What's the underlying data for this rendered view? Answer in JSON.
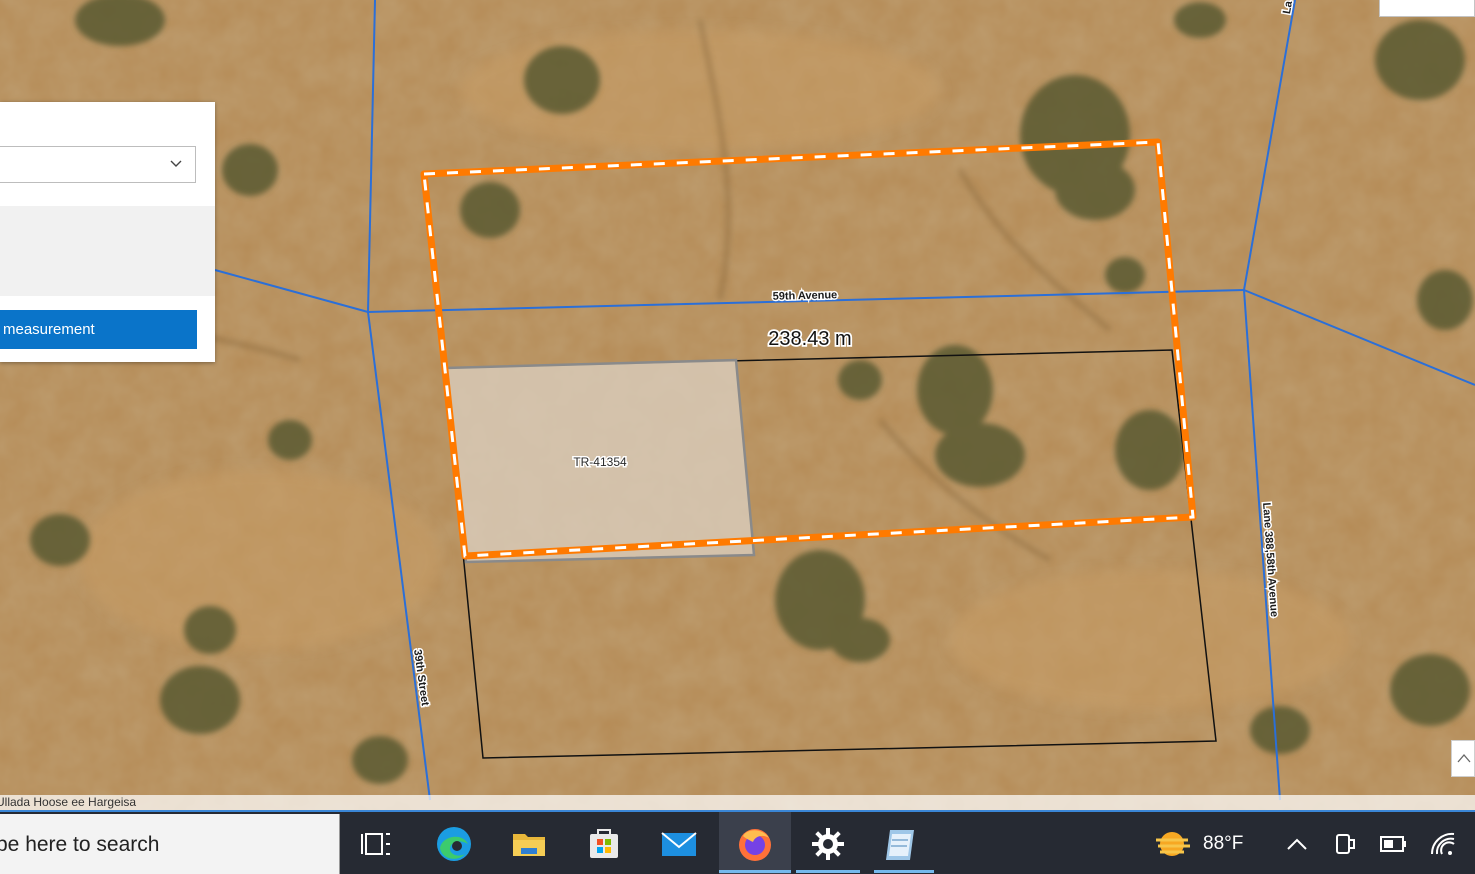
{
  "map": {
    "roads": [
      {
        "name": "59th Avenue"
      },
      {
        "name": "39th Street"
      },
      {
        "name": "Lane 388,58th Avenue"
      },
      {
        "name": "La"
      }
    ],
    "parcel": {
      "id": "TR-41354"
    },
    "measurement": {
      "distance": "238.43 m"
    },
    "colors": {
      "road_line": "#2b6fd8",
      "measure_outline": "#ff7a00",
      "measure_dash": "#ffffff",
      "parcel_fill": "#d9ccbb",
      "parcel_stroke": "#8a8a8a",
      "boundary": "#111111"
    }
  },
  "panel": {
    "dropdown_icon": "chevron-down-icon",
    "button_label": "measurement"
  },
  "attribution": {
    "text": "Ullada Hoose ee Hargeisa"
  },
  "taskbar": {
    "search_placeholder": "pe here to search",
    "apps": [
      "task-view-icon",
      "edge-icon",
      "file-explorer-icon",
      "store-icon",
      "mail-icon",
      "firefox-icon",
      "settings-icon",
      "notepad-icon"
    ],
    "weather": {
      "temperature": "88°F",
      "icon": "sun-icon"
    },
    "tray_icons": [
      "chevron-up-icon",
      "meet-icon",
      "battery-icon",
      "wifi-icon"
    ]
  }
}
